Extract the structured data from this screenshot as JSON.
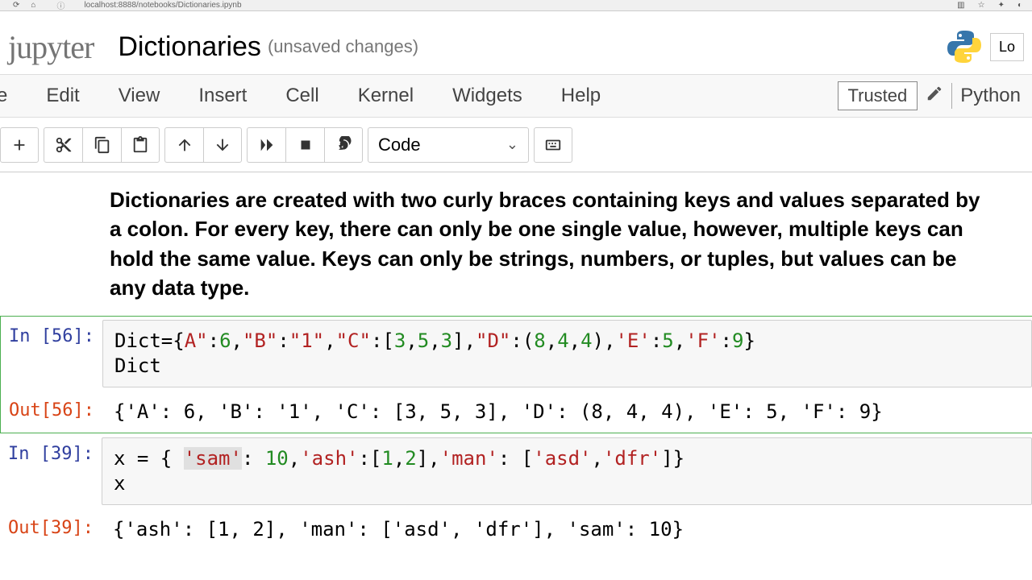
{
  "browser": {
    "url": "localhost:8888/notebooks/Dictionaries.ipynb"
  },
  "header": {
    "logo": "jupyter",
    "title": "Dictionaries",
    "status": "(unsaved changes)",
    "login_visible": "Lo"
  },
  "menubar": {
    "items": [
      "e",
      "Edit",
      "View",
      "Insert",
      "Cell",
      "Kernel",
      "Widgets",
      "Help"
    ],
    "trusted": "Trusted",
    "kernel_name": "Python"
  },
  "toolbar": {
    "cell_type": "Code"
  },
  "markdown": {
    "text": "Dictionaries are created with two curly braces containing keys and values separated by a colon. For every key, there can only be one single value, however, multiple keys can hold the same value. Keys can only be strings, numbers, or tuples, but values can be any data type."
  },
  "cells": [
    {
      "in_label": "In [56]:",
      "out_label": "Out[56]:",
      "code_line1_parts": {
        "p1": "Dict={",
        "p2": "A\"",
        "p3": ":",
        "p4": "6",
        "p5": ",",
        "p6": "\"B\"",
        "p7": ":",
        "p8": "\"1\"",
        "p9": ",",
        "p10": "\"C\"",
        "p11": ":[",
        "p12": "3",
        "p13": ",",
        "p14": "5",
        "p15": ",",
        "p16": "3",
        "p17": "],",
        "p18": "\"D\"",
        "p19": ":(",
        "p20": "8",
        "p21": ",",
        "p22": "4",
        "p23": ",",
        "p24": "4",
        "p25": "),",
        "p26": "'E'",
        "p27": ":",
        "p28": "5",
        "p29": ",",
        "p30": "'F'",
        "p31": ":",
        "p32": "9",
        "p33": "}"
      },
      "code_line2": "Dict",
      "output": "{'A': 6, 'B': '1', 'C': [3, 5, 3], 'D': (8, 4, 4), 'E': 5, 'F': 9}"
    },
    {
      "in_label": "In [39]:",
      "out_label": "Out[39]:",
      "code_line1_parts": {
        "p1": "x = { ",
        "p2": "'sam'",
        "p3": ": ",
        "p4": "10",
        "p5": ",",
        "p6": "'ash'",
        "p7": ":[",
        "p8": "1",
        "p9": ",",
        "p10": "2",
        "p11": "],",
        "p12": "'man'",
        "p13": ": [",
        "p14": "'asd'",
        "p15": ",",
        "p16": "'dfr'",
        "p17": "]}"
      },
      "code_line2": "x",
      "output": "{'ash': [1, 2], 'man': ['asd', 'dfr'], 'sam': 10}"
    }
  ]
}
